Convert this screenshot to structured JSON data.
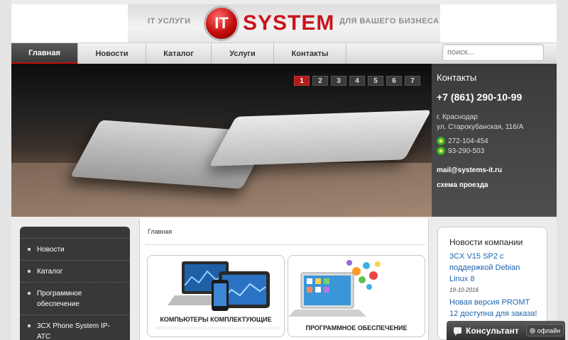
{
  "header": {
    "tagline_left": "IT УСЛУГИ",
    "logo_ball_text": "IT",
    "logo_word": "SYSTEM",
    "tagline_right": "ДЛЯ ВАШЕГО БИЗНЕСА"
  },
  "nav": {
    "items": [
      {
        "label": "Главная",
        "active": true
      },
      {
        "label": "Новости"
      },
      {
        "label": "Каталог"
      },
      {
        "label": "Услуги"
      },
      {
        "label": "Контакты"
      }
    ],
    "search_placeholder": "поиск..."
  },
  "slider": {
    "pages": [
      "1",
      "2",
      "3",
      "4",
      "5",
      "6",
      "7"
    ],
    "active_page": "1"
  },
  "contacts": {
    "title": "Контакты",
    "phone": "+7 (861) 290-10-99",
    "city": "г. Краснодар",
    "address": "ул. Старокубанская, 116/А",
    "icq1": "272-104-454",
    "icq2": "93-290-503",
    "email": "mail@systems-it.ru",
    "route": "схема проезда"
  },
  "sidebar": {
    "items": [
      {
        "label": "Новости"
      },
      {
        "label": "Каталог"
      },
      {
        "label": "Программное обеспечение"
      },
      {
        "label": "3CX Phone System IP-АТС"
      }
    ]
  },
  "main": {
    "breadcrumb": "Главная",
    "cards": [
      {
        "caption": "КОМПЬЮТЕРЫ КОМПЛЕКТУЮЩИЕ"
      },
      {
        "caption": "ПРОГРАММНОЕ ОБЕСПЕЧЕНИЕ"
      }
    ]
  },
  "news": {
    "title": "Новости компании",
    "items": [
      {
        "title": "3CX V15 SP2 с поддержкой Debian Linux 8",
        "date": "19-10-2016"
      },
      {
        "title": "Новая версия PROMT 12 доступна для заказа!",
        "date": ""
      }
    ]
  },
  "consultant": {
    "label": "Консультант",
    "status": "офлайн"
  },
  "colors": {
    "accent": "#c8141b",
    "link": "#1b63b0",
    "dark_panel": "#3b3b3b"
  }
}
